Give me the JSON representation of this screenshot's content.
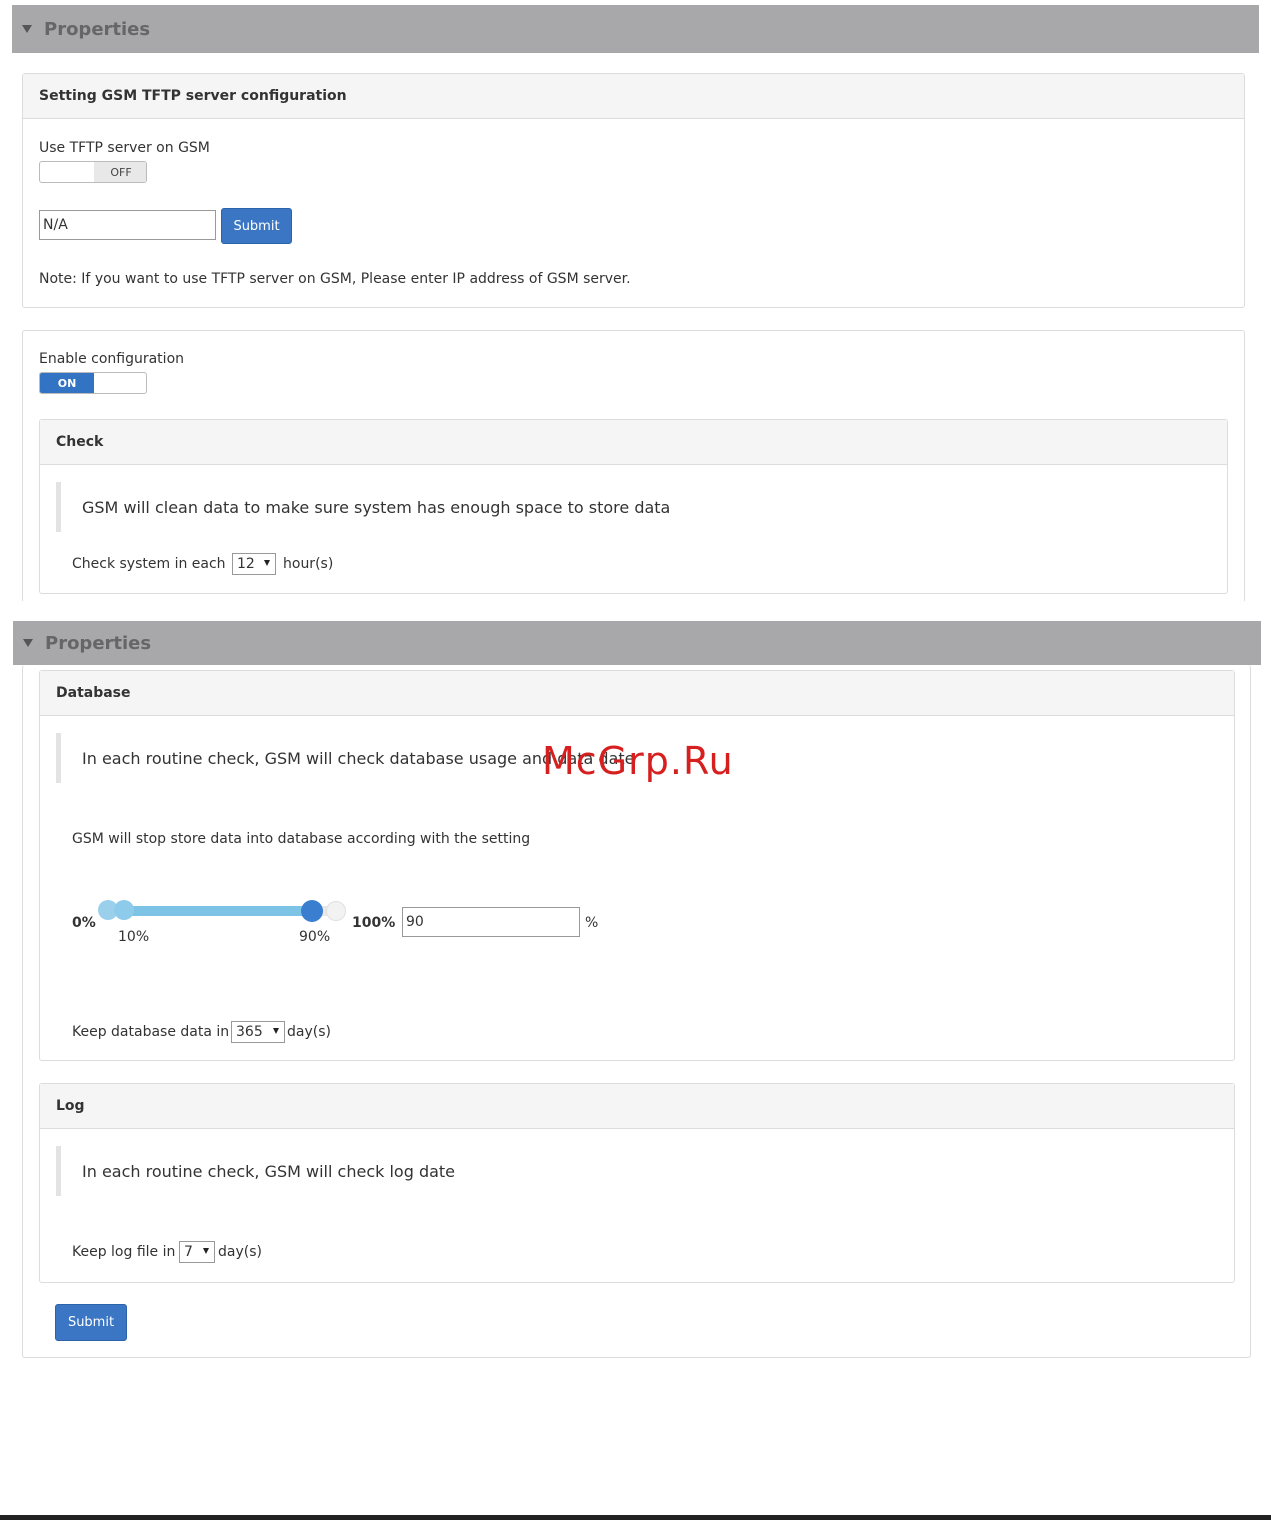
{
  "properties_label": "Properties",
  "tftp": {
    "title": "Setting GSM TFTP server configuration",
    "use_label": "Use TFTP server on GSM",
    "toggle_state": "OFF",
    "server_value": "N/A",
    "submit_label": "Submit",
    "note": "Note: If you want to use TFTP server on GSM, Please enter IP address of GSM server."
  },
  "enable": {
    "label": "Enable configuration",
    "toggle_state": "ON"
  },
  "check": {
    "title": "Check",
    "description": "GSM will clean data to make sure system has enough space to store data",
    "interval_label": "Check system in each",
    "interval_value": "12",
    "interval_unit": "hour(s)"
  },
  "database": {
    "title": "Database",
    "description": "In each routine check, GSM will check database usage and data date",
    "stop_text": "GSM will stop store data into database according with the setting",
    "slider": {
      "min_label": "0%",
      "max_label": "100%",
      "low_label": "10%",
      "high_label": "90%",
      "low_value": 10,
      "high_value": 90
    },
    "threshold_value": "90",
    "threshold_unit": "%",
    "keep_label": "Keep database data in",
    "keep_value": "365",
    "keep_unit": "day(s)"
  },
  "log": {
    "title": "Log",
    "description": "In each routine check, GSM will check log date",
    "keep_label": "Keep log file in",
    "keep_value": "7",
    "keep_unit": "day(s)"
  },
  "submit_label": "Submit",
  "watermark": "McGrp.Ru",
  "colors": {
    "header_bar": "#a8a8ab",
    "primary_button": "#3a76c4",
    "slider_track": "#7cc3e6",
    "slider_handle": "#3a7fcf"
  }
}
